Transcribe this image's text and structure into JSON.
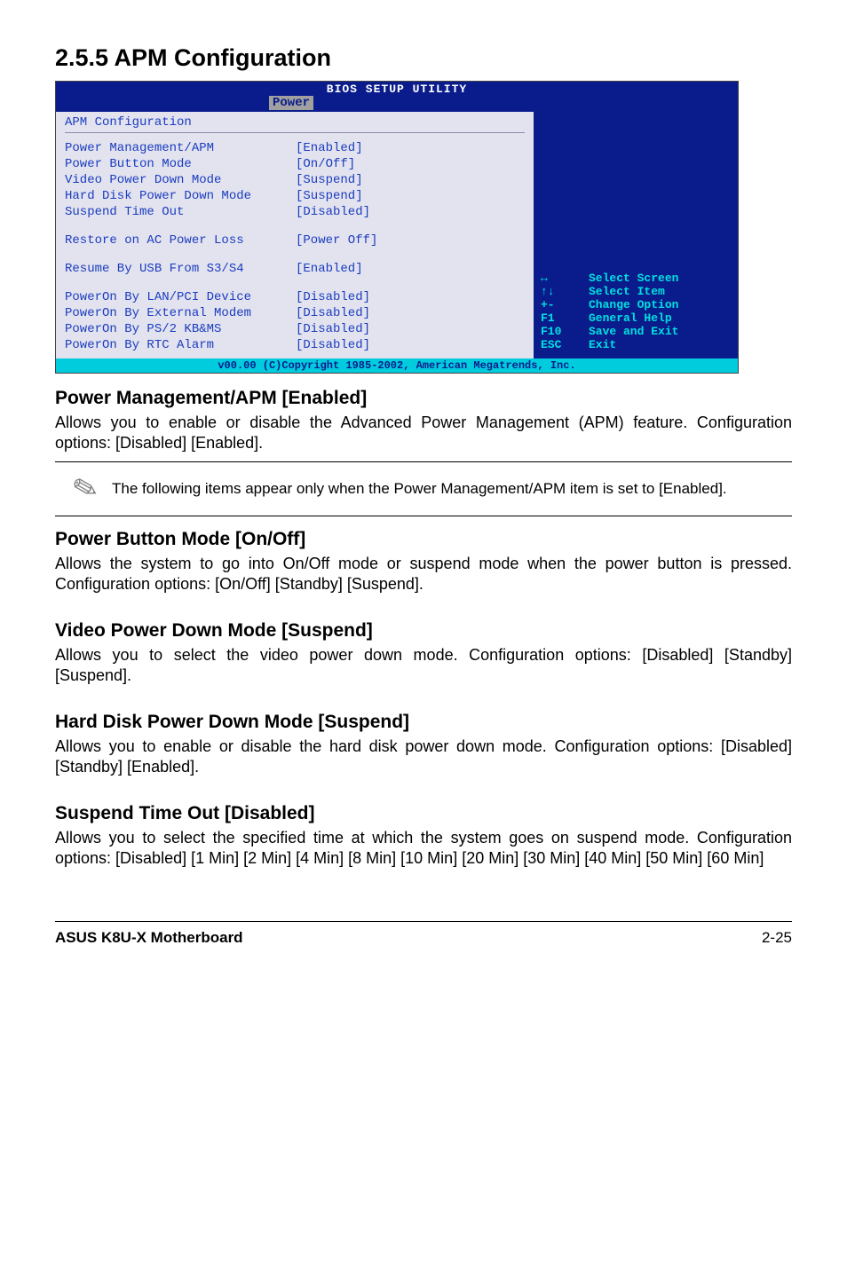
{
  "page_title": "2.5.5 APM Configuration",
  "bios": {
    "utility_title": "BIOS SETUP UTILITY",
    "tab_label": "Power",
    "section_label": "APM Configuration",
    "left_rows_a": [
      {
        "label": "Power Management/APM",
        "value": "[Enabled]"
      },
      {
        "label": "Power Button Mode",
        "value": "[On/Off]"
      },
      {
        "label": "Video Power Down Mode",
        "value": "[Suspend]"
      },
      {
        "label": "Hard Disk Power Down Mode",
        "value": "[Suspend]"
      },
      {
        "label": "Suspend Time Out",
        "value": "[Disabled]"
      }
    ],
    "left_rows_b": [
      {
        "label": "Restore on AC Power Loss",
        "value": "[Power Off]"
      }
    ],
    "left_rows_c": [
      {
        "label": "Resume By USB From S3/S4",
        "value": "[Enabled]"
      }
    ],
    "left_rows_d": [
      {
        "label": "PowerOn By LAN/PCI Device",
        "value": "[Disabled]"
      },
      {
        "label": "PowerOn By External Modem",
        "value": "[Disabled]"
      },
      {
        "label": "PowerOn By PS/2 KB&MS",
        "value": "[Disabled]"
      },
      {
        "label": "PowerOn By RTC Alarm",
        "value": "[Disabled]"
      }
    ],
    "help_rows": [
      {
        "key": "↔",
        "text": "Select Screen"
      },
      {
        "key": "↑↓",
        "text": "Select Item"
      },
      {
        "key": "+-",
        "text": "Change Option"
      },
      {
        "key": "F1",
        "text": "General Help"
      },
      {
        "key": "F10",
        "text": "Save and Exit"
      },
      {
        "key": "ESC",
        "text": "Exit"
      }
    ],
    "footer_text": "v00.00 (C)Copyright 1985-2002, American Megatrends, Inc."
  },
  "sections": {
    "s1_h": "Power Management/APM [Enabled]",
    "s1_p": "Allows you to enable or disable the Advanced Power Management (APM) feature. Configuration options: [Disabled] [Enabled].",
    "note": "The following items appear only when the Power Management/APM item is set to [Enabled].",
    "s2_h": "Power Button Mode [On/Off]",
    "s2_p": "Allows the system to go into On/Off mode or suspend mode when the power button is pressed. Configuration options: [On/Off] [Standby] [Suspend].",
    "s3_h": "Video Power Down Mode [Suspend]",
    "s3_p": "Allows you to select the video power down mode. Configuration options: [Disabled] [Standby] [Suspend].",
    "s4_h": "Hard Disk Power Down Mode [Suspend]",
    "s4_p": "Allows you to enable or disable the hard disk power down mode. Configuration options: [Disabled] [Standby] [Enabled].",
    "s5_h": "Suspend Time Out [Disabled]",
    "s5_p": "Allows you to select the specified time at which the system goes on suspend mode. Configuration options: [Disabled] [1 Min] [2 Min] [4 Min] [8 Min] [10 Min] [20 Min] [30 Min] [40 Min] [50 Min] [60 Min]"
  },
  "footer": {
    "left": "ASUS K8U-X Motherboard",
    "right": "2-25"
  }
}
